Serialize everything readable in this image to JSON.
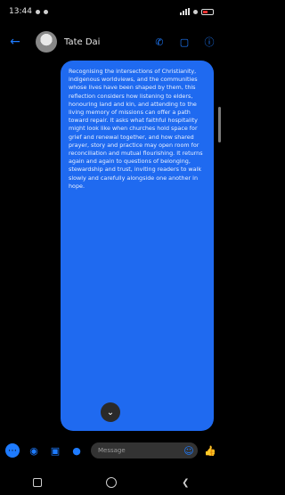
{
  "status_bar": {
    "time": "13:44",
    "icons": [
      "signal-icon",
      "wifi-icon",
      "battery-icon"
    ]
  },
  "header": {
    "contact_name": "Tate Dai",
    "icons": [
      "back-arrow-icon",
      "phone-icon",
      "video-camera-icon",
      "info-icon"
    ]
  },
  "conversation": {
    "message_text": "Recognising the intersections of Christianity, indigenous worldviews, and the communities whose lives have been shaped by them, this reflection considers how listening to elders, honouring land and kin, and attending to the living memory of missions can offer a path toward repair. It asks what faithful hospitality might look like when churches hold space for grief and renewal together, and how shared prayer, story and practice may open room for reconciliation and mutual flourishing. It returns again and again to questions of belonging, stewardship and trust, inviting readers to walk slowly and carefully alongside one another in hope."
  },
  "composer": {
    "placeholder": "Message",
    "icons": [
      "apps-icon",
      "camera-icon",
      "photo-icon",
      "microphone-icon",
      "emoji-icon",
      "like-icon"
    ]
  },
  "nav_bar": {
    "icons": [
      "recents-icon",
      "home-icon",
      "back-icon"
    ]
  },
  "colors": {
    "accent": "#1e7bff",
    "bubble": "#1f6af0",
    "background": "#000000"
  }
}
